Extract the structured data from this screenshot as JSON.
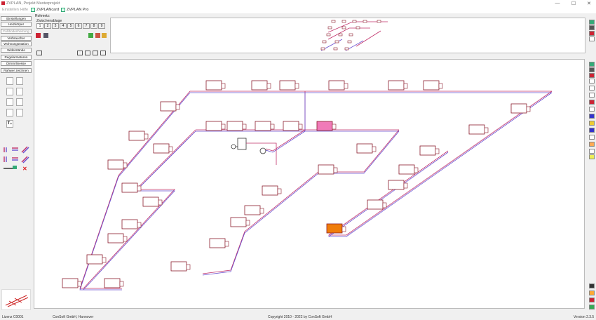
{
  "window": {
    "title": "ZVPLAN, Projekt Musterprojekt",
    "minimize": "—",
    "maximize": "☐",
    "close": "✕"
  },
  "menu": {
    "items": [
      "Einstellen",
      "Hilfe"
    ],
    "tools": [
      "ZVPLANcard",
      "ZVPLAN Pro"
    ]
  },
  "sidebar": {
    "buttons": [
      {
        "label": "Einstellungen",
        "dim": false
      },
      {
        "label": "Heizkörper",
        "dim": false
      },
      {
        "label": "Fußbodenheizung",
        "dim": true
      },
      {
        "label": "Verbraucher",
        "dim": false
      },
      {
        "label": "Wohnungsstation",
        "dim": false
      },
      {
        "label": "Widerstände",
        "dim": false
      },
      {
        "label": "Regelarmaturen",
        "dim": false
      },
      {
        "label": "Dimmrlinesse",
        "dim": false
      },
      {
        "label": "Rahwer zeichnen",
        "dim": false
      }
    ],
    "text_tool": "T₊"
  },
  "top": {
    "rohmetz": "Rohmetz:",
    "zwischenablage": "Zwischenablage",
    "tabs": [
      "1",
      "2",
      "3",
      "4",
      "5",
      "6",
      "7",
      "8",
      "9"
    ]
  },
  "status": {
    "left": "Lizenz C0001",
    "company": "ConSoft GmbH, Hannover",
    "copyright": "Copyright 2010 - 2022 by ConSoft GmbH",
    "version": "Version 2.3.5"
  },
  "colors": {
    "pipe_supply": "#c0306a",
    "pipe_return": "#6a4fd0",
    "radiator": "#8a1b2b",
    "highlight_pink": "#f07ab8",
    "highlight_orange": "#f07d0a"
  }
}
